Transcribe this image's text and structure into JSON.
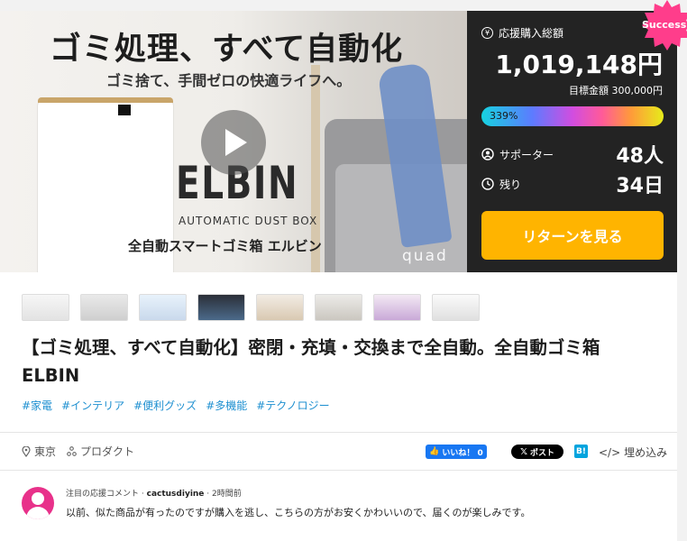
{
  "hero": {
    "title": "ゴミ処理、すべて自動化",
    "subtitle": "ゴミ捨て、手間ゼロの快適ライフへ。",
    "brand": "ELBIN",
    "brand_sub": "AUTOMATIC DUST BOX",
    "caption": "全自動スマートゴミ箱 エルビン",
    "maker": "quad"
  },
  "panel": {
    "amount_label": "応援購入総額",
    "amount": "1,019,148円",
    "goal": "目標金額 300,000円",
    "progress_label": "339%",
    "progress_percent": 339,
    "supporters_label": "サポーター",
    "supporters": "48人",
    "remaining_label": "残り",
    "remaining": "34日",
    "cta": "リターンを見る",
    "badge": "Success!"
  },
  "project": {
    "title": "【ゴミ処理、すべて自動化】密閉・充填・交換まで全自動。全自動ゴミ箱 ELBIN",
    "tags": [
      "#家電",
      "#インテリア",
      "#便利グッズ",
      "#多機能",
      "#テクノロジー"
    ],
    "location": "東京",
    "category": "プロダクト"
  },
  "share": {
    "like": "いいね！ 0",
    "post": "ポスト",
    "hatena": "B!",
    "embed": "埋め込み"
  },
  "comment": {
    "heading": "注目の応援コメント",
    "user": "cactusdiyine",
    "time": "2時間前",
    "text": "以前、似た商品が有ったのですが購入を逃し、こちらの方がお安くかわいいので、届くのが楽しみです。"
  },
  "colors": {
    "cta": "#ffb400",
    "panel_bg": "#232323",
    "badge": "#ff3d8b",
    "tag": "#1d8fd0",
    "avatar": "#e8318a"
  }
}
